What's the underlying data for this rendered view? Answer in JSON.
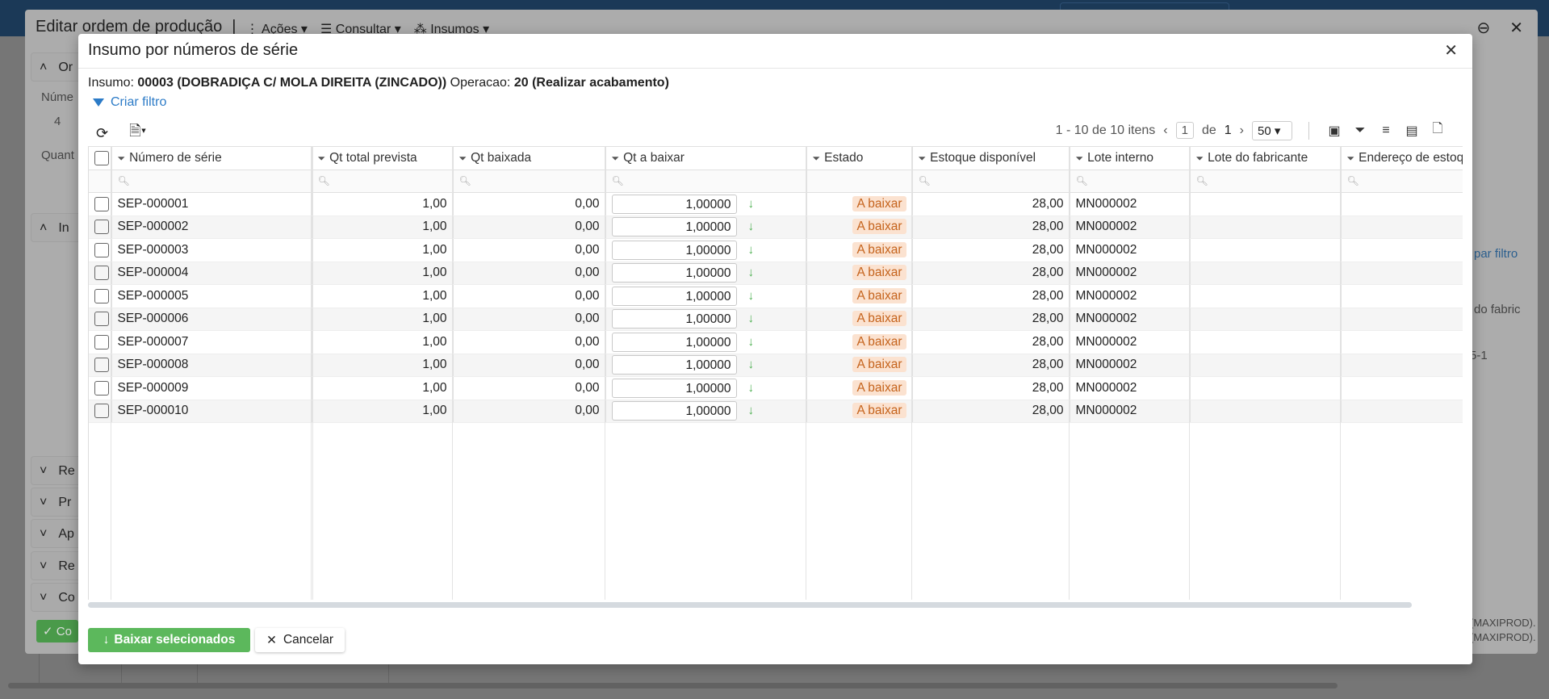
{
  "background": {
    "window_title": "Editar ordem de produção",
    "menu": [
      "Ações",
      "Consultar",
      "Insumos"
    ],
    "sections": [
      "Or",
      "In",
      "Re",
      "Pr",
      "Ap",
      "Re",
      "Co"
    ],
    "field_label_1": "Núme",
    "field_value_1": "4",
    "field_label_2": "Quant",
    "confirm_button": "Co",
    "right_texts": [
      "par filtro",
      "do fabric",
      "5-1",
      "(MAXIPROD).",
      "(MAXIPROD)."
    ]
  },
  "modal": {
    "title": "Insumo por números de série",
    "insumo_label": "Insumo:",
    "insumo_value": "00003 (DOBRADIÇA C/ MOLA DIREITA (ZINCADO))",
    "operacao_label": "Operacao:",
    "operacao_value": "20 (Realizar acabamento)",
    "create_filter": "Criar filtro",
    "pager": {
      "summary": "1 - 10 de 10 itens",
      "page": "1",
      "of_label": "de",
      "total_pages": "1",
      "page_size": "50"
    },
    "columns": [
      "Número de série",
      "Qt total prevista",
      "Qt baixada",
      "Qt a baixar",
      "Estado",
      "Estoque disponível",
      "Lote interno",
      "Lote do fabricante",
      "Endereço de estoque"
    ],
    "rows": [
      {
        "serie": "SEP-000001",
        "prevista": "1,00",
        "baixada": "0,00",
        "a_baixar": "1,00000",
        "estado": "A baixar",
        "estoque": "28,00",
        "lote": "MN000002"
      },
      {
        "serie": "SEP-000002",
        "prevista": "1,00",
        "baixada": "0,00",
        "a_baixar": "1,00000",
        "estado": "A baixar",
        "estoque": "28,00",
        "lote": "MN000002"
      },
      {
        "serie": "SEP-000003",
        "prevista": "1,00",
        "baixada": "0,00",
        "a_baixar": "1,00000",
        "estado": "A baixar",
        "estoque": "28,00",
        "lote": "MN000002"
      },
      {
        "serie": "SEP-000004",
        "prevista": "1,00",
        "baixada": "0,00",
        "a_baixar": "1,00000",
        "estado": "A baixar",
        "estoque": "28,00",
        "lote": "MN000002"
      },
      {
        "serie": "SEP-000005",
        "prevista": "1,00",
        "baixada": "0,00",
        "a_baixar": "1,00000",
        "estado": "A baixar",
        "estoque": "28,00",
        "lote": "MN000002"
      },
      {
        "serie": "SEP-000006",
        "prevista": "1,00",
        "baixada": "0,00",
        "a_baixar": "1,00000",
        "estado": "A baixar",
        "estoque": "28,00",
        "lote": "MN000002"
      },
      {
        "serie": "SEP-000007",
        "prevista": "1,00",
        "baixada": "0,00",
        "a_baixar": "1,00000",
        "estado": "A baixar",
        "estoque": "28,00",
        "lote": "MN000002"
      },
      {
        "serie": "SEP-000008",
        "prevista": "1,00",
        "baixada": "0,00",
        "a_baixar": "1,00000",
        "estado": "A baixar",
        "estoque": "28,00",
        "lote": "MN000002"
      },
      {
        "serie": "SEP-000009",
        "prevista": "1,00",
        "baixada": "0,00",
        "a_baixar": "1,00000",
        "estado": "A baixar",
        "estoque": "28,00",
        "lote": "MN000002"
      },
      {
        "serie": "SEP-000010",
        "prevista": "1,00",
        "baixada": "0,00",
        "a_baixar": "1,00000",
        "estado": "A baixar",
        "estoque": "28,00",
        "lote": "MN000002"
      }
    ],
    "buttons": {
      "confirm": "Baixar selecionados",
      "cancel": "Cancelar"
    }
  },
  "colors": {
    "accent": "#2c7bc7",
    "success": "#5cb85c",
    "badge_bg": "#fbe2d0",
    "badge_fg": "#c5631c",
    "header": "#1b3957"
  }
}
